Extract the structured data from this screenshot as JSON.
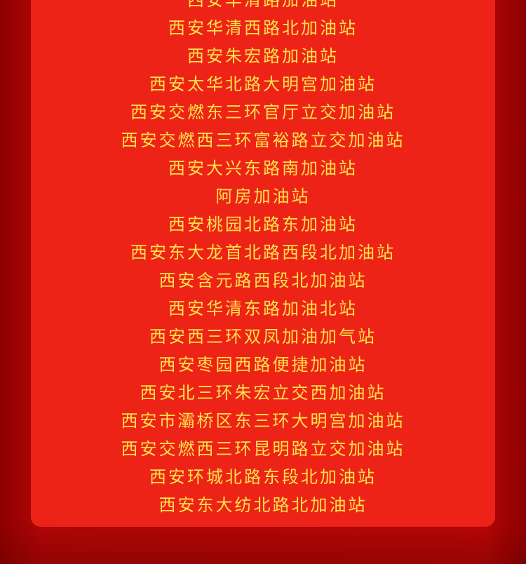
{
  "stations": [
    "西安华清路加油站",
    "西安华清西路北加油站",
    "西安朱宏路加油站",
    "西安太华北路大明宫加油站",
    "西安交燃东三环官厅立交加油站",
    "西安交燃西三环富裕路立交加油站",
    "西安大兴东路南加油站",
    "阿房加油站",
    "西安桃园北路东加油站",
    "西安东大龙首北路西段北加油站",
    "西安含元路西段北加油站",
    "西安华清东路加油北站",
    "西安西三环双凤加油加气站",
    "西安枣园西路便捷加油站",
    "西安北三环朱宏立交西加油站",
    "西安市灞桥区东三环大明宫加油站",
    "西安交燃西三环昆明路立交加油站",
    "西安环城北路东段北加油站",
    "西安东大纺北路北加油站"
  ],
  "colors": {
    "background": "#b70606",
    "panel": "#ee2318",
    "text": "#ffe24a"
  }
}
